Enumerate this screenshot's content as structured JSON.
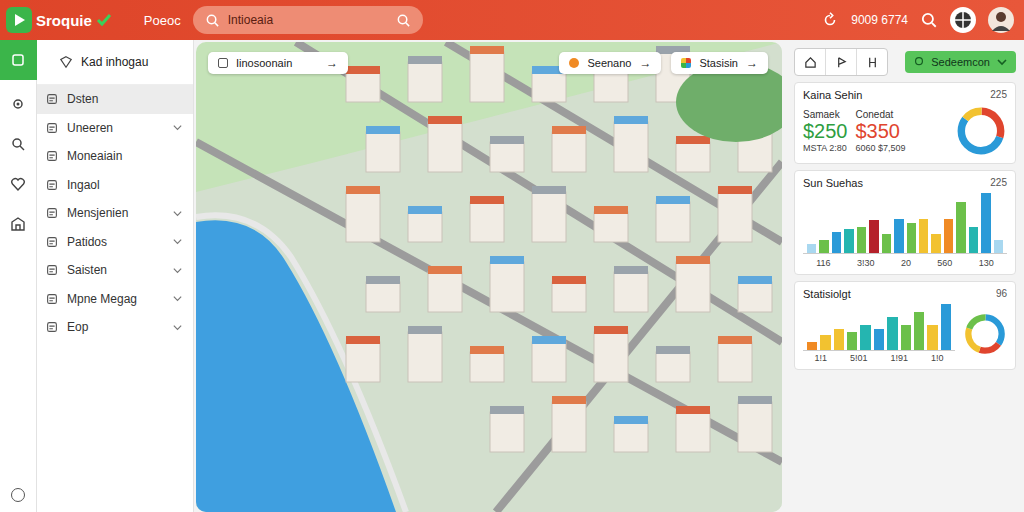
{
  "topbar": {
    "logo": "Sroquie",
    "nav": "Poeoc",
    "search": {
      "value": "Intioeaia"
    },
    "counter": "9009 6774"
  },
  "rail": [
    {
      "selected": true
    },
    {
      "selected": false
    },
    {
      "selected": false
    },
    {
      "selected": false
    },
    {
      "selected": false
    }
  ],
  "sidebar": {
    "header": "Kad inhogau",
    "items": [
      {
        "label": "Dsten",
        "selected": true,
        "expandable": false
      },
      {
        "label": "Uneeren",
        "selected": false,
        "expandable": true
      },
      {
        "label": "Moneaiain",
        "selected": false,
        "expandable": false
      },
      {
        "label": "Ingaol",
        "selected": false,
        "expandable": false
      },
      {
        "label": "Mensjenien",
        "selected": false,
        "expandable": true
      },
      {
        "label": "Patidos",
        "selected": false,
        "expandable": true
      },
      {
        "label": "Saisten",
        "selected": false,
        "expandable": true
      },
      {
        "label": "Mpne Megag",
        "selected": false,
        "expandable": true
      },
      {
        "label": "Eop",
        "selected": false,
        "expandable": true
      }
    ]
  },
  "map": {
    "chips": [
      {
        "label": "Iinosoonain",
        "arrow": "→"
      },
      {
        "label": "Seenano",
        "arrow": "→"
      },
      {
        "label": "Stasisin",
        "arrow": "→"
      }
    ]
  },
  "toolbar": {
    "button": "Sedeemcon"
  },
  "summary": {
    "title": "Kaina Sehin",
    "badge": "225",
    "stats": [
      {
        "label": "Samaek",
        "value": "$250",
        "sub": "MSTA 2:80",
        "color": "#2e9e3f"
      },
      {
        "label": "Conedat",
        "value": "$350",
        "sub": "6060 $7,509",
        "color": "#e0452e"
      }
    ],
    "donut": [
      {
        "value": 30,
        "color": "#e0452e"
      },
      {
        "value": 55,
        "color": "#2a9ad8"
      },
      {
        "value": 15,
        "color": "#f2c230"
      }
    ]
  },
  "sales": {
    "title": "Sun Suehas",
    "badge": "225",
    "bars": [
      {
        "value": 10,
        "color": "#a9d8f0"
      },
      {
        "value": 15,
        "color": "#6cc04a"
      },
      {
        "value": 25,
        "color": "#2a9ad8"
      },
      {
        "value": 28,
        "color": "#25b5b0"
      },
      {
        "value": 30,
        "color": "#6cc04a"
      },
      {
        "value": 38,
        "color": "#b5212b"
      },
      {
        "value": 22,
        "color": "#6cc04a"
      },
      {
        "value": 40,
        "color": "#2a9ad8"
      },
      {
        "value": 35,
        "color": "#6cc04a"
      },
      {
        "value": 40,
        "color": "#f2c230"
      },
      {
        "value": 22,
        "color": "#f2c230"
      },
      {
        "value": 40,
        "color": "#f08a24"
      },
      {
        "value": 60,
        "color": "#6cc04a"
      },
      {
        "value": 30,
        "color": "#25b5b0"
      },
      {
        "value": 70,
        "color": "#2a9ad8"
      },
      {
        "value": 15,
        "color": "#a9d8f0"
      }
    ],
    "ticks": [
      "116",
      "3!30",
      "20",
      "560",
      "130"
    ]
  },
  "stats": {
    "title": "Statisiolgt",
    "badge": "96",
    "bars": [
      {
        "value": 10,
        "color": "#f08a24"
      },
      {
        "value": 18,
        "color": "#f2c230"
      },
      {
        "value": 25,
        "color": "#f2c230"
      },
      {
        "value": 22,
        "color": "#6cc04a"
      },
      {
        "value": 30,
        "color": "#25b5b0"
      },
      {
        "value": 25,
        "color": "#2a9ad8"
      },
      {
        "value": 40,
        "color": "#25b5b0"
      },
      {
        "value": 30,
        "color": "#6cc04a"
      },
      {
        "value": 45,
        "color": "#6cc04a"
      },
      {
        "value": 30,
        "color": "#f2c230"
      },
      {
        "value": 55,
        "color": "#2a9ad8"
      }
    ],
    "ticks": [
      "1!1",
      "5!01",
      "1!91",
      "1!0"
    ],
    "donut": [
      {
        "value": 35,
        "color": "#2a9ad8"
      },
      {
        "value": 20,
        "color": "#e0452e"
      },
      {
        "value": 25,
        "color": "#f2c230"
      },
      {
        "value": 20,
        "color": "#6cc04a"
      }
    ]
  }
}
